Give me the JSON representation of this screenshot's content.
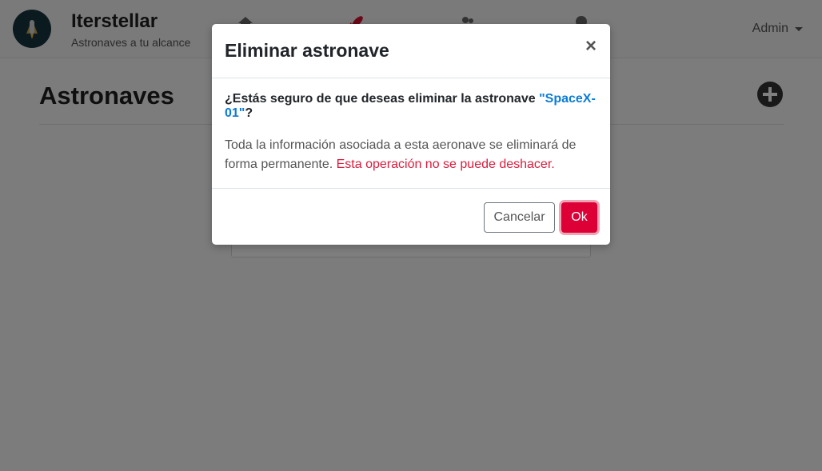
{
  "navbar": {
    "brand_title": "Iterstellar",
    "brand_subtitle": "Astronaves a tu alcance",
    "icons": [
      "home-icon",
      "rocket-icon",
      "users-icon",
      "map-marker-icon"
    ],
    "user_menu_label": "Admin"
  },
  "page": {
    "title": "Astronaves",
    "add_icon": "plus-circle-icon"
  },
  "modal": {
    "title": "Eliminar astronave",
    "close_label": "×",
    "question_prefix": "¿Estás seguro de que deseas eliminar la astronave ",
    "ship_name": "\"SpaceX-01\"",
    "question_suffix": "?",
    "info_text": "Toda la información asociada a esta aeronave se eliminará de forma permanente. ",
    "warning_text": "Esta operación no se puede deshacer.",
    "cancel_label": "Cancelar",
    "ok_label": "Ok"
  },
  "colors": {
    "accent_link": "#0a7bd8",
    "danger": "#dc0037",
    "warning_text": "#dc1c3d",
    "backdrop": "rgba(0,0,0,0.5)"
  }
}
